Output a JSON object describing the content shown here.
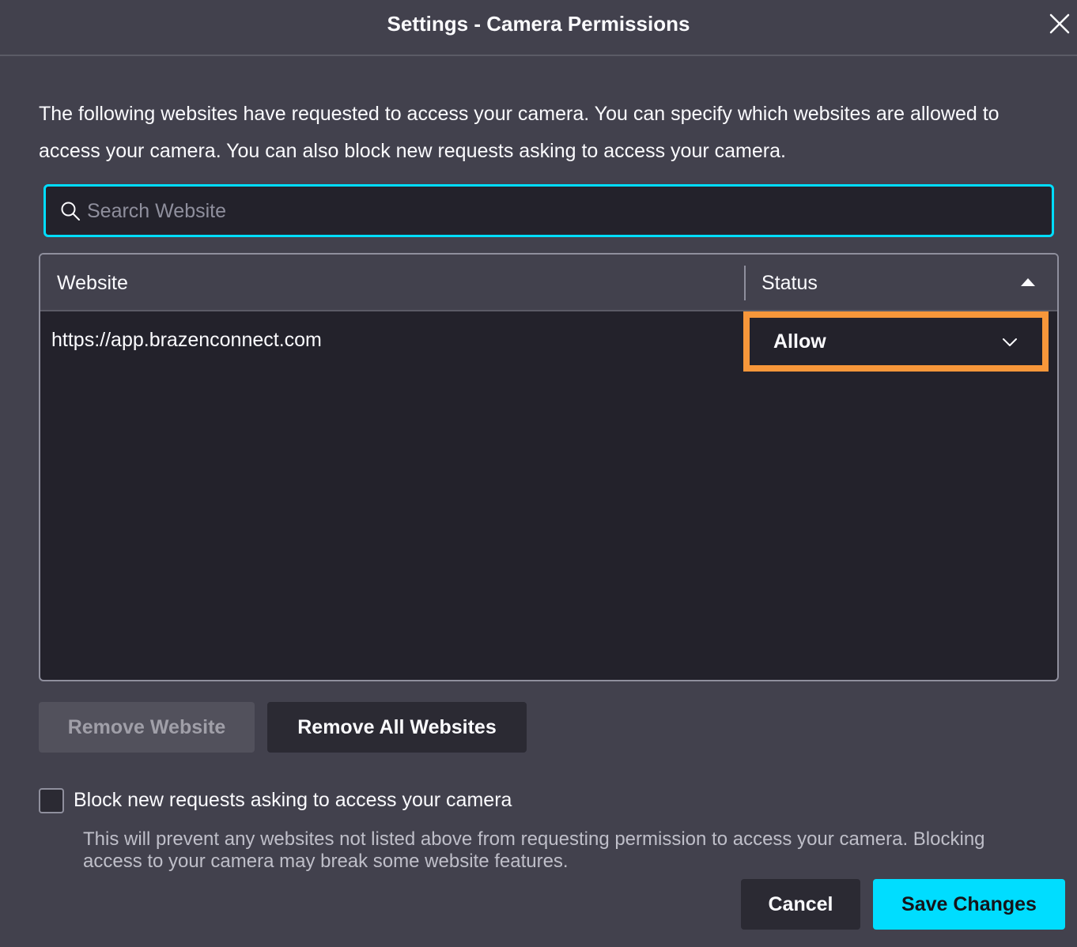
{
  "dialog": {
    "title": "Settings - Camera Permissions",
    "description": "The following websites have requested to access your camera. You can specify which websites are allowed to access your camera. You can also block new requests asking to access your camera."
  },
  "search": {
    "placeholder": "Search Website",
    "value": ""
  },
  "table": {
    "columns": {
      "website": "Website",
      "status": "Status"
    },
    "sort": "status-ascending",
    "rows": [
      {
        "url": "https://app.brazenconnect.com",
        "status": "Allow"
      }
    ]
  },
  "buttons": {
    "remove_website": "Remove Website",
    "remove_all": "Remove All Websites",
    "cancel": "Cancel",
    "save": "Save Changes"
  },
  "block_option": {
    "label": "Block new requests asking to access your camera",
    "checked": false,
    "hint": "This will prevent any websites not listed above from requesting permission to access your camera. Blocking access to your camera may break some website features."
  },
  "icons": {
    "close": "close-icon",
    "search": "search-icon",
    "sort": "sort-up-arrow-icon",
    "dropdown": "chevron-down-icon"
  },
  "colors": {
    "accent": "#00ddff",
    "highlight": "#f7973a",
    "background": "#42414d",
    "panel": "#23222b"
  }
}
